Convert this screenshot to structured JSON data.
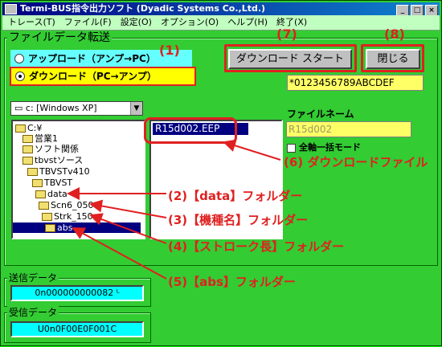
{
  "window": {
    "title": "Termi-BUS指令出力ソフト (Dyadic Systems Co.,Ltd.)",
    "controls": [
      "_",
      "□",
      "×"
    ]
  },
  "menu": [
    "トレース(T)",
    "ファイル(F)",
    "設定(O)",
    "オプション(O)",
    "ヘルプ(H)",
    "終了(X)"
  ],
  "transfer": {
    "group_title": "ファイルデータ転送",
    "upload_label": "アップロード（アンプ→PC）",
    "download_label": "ダウンロード（PC→アンプ）",
    "download_selected": true,
    "start_button": "ダウンロード スタート",
    "close_button": "閉じる",
    "hex_value": "*0123456789ABCDEF",
    "drive": "c: [Windows XP]",
    "file_name_label": "ファイルネーム",
    "file_name_value": "R15d002",
    "batch_mode_label": "全軸一括モード"
  },
  "tree": [
    "C:¥",
    "営業1",
    "ソフト関係",
    "tbvstソース",
    "TBVSTv410",
    "TBVST",
    "data",
    "Scn6_050",
    "Strk_150",
    "abs"
  ],
  "files": [
    "R15d002.EEP"
  ],
  "send": {
    "title": "送信データ",
    "value": "0n000000000082 ᴸ"
  },
  "recv": {
    "title": "受信データ",
    "value": "U0n0F00E0F001C"
  },
  "annotations": {
    "n1": "(1)",
    "n7": "(7)",
    "n8": "(8)",
    "a2": "(2)【data】フォルダー",
    "a3": "(3)【機種名】フォルダー",
    "a4": "(4)【ストローク長】フォルダー",
    "a5": "(5)【abs】フォルダー",
    "a6": "(6) ダウンロードファイル"
  },
  "colors": {
    "annotation": "#e02020",
    "window_bg": "#33cc33",
    "highlight": "#ffff66",
    "data_field": "#00ffff"
  }
}
